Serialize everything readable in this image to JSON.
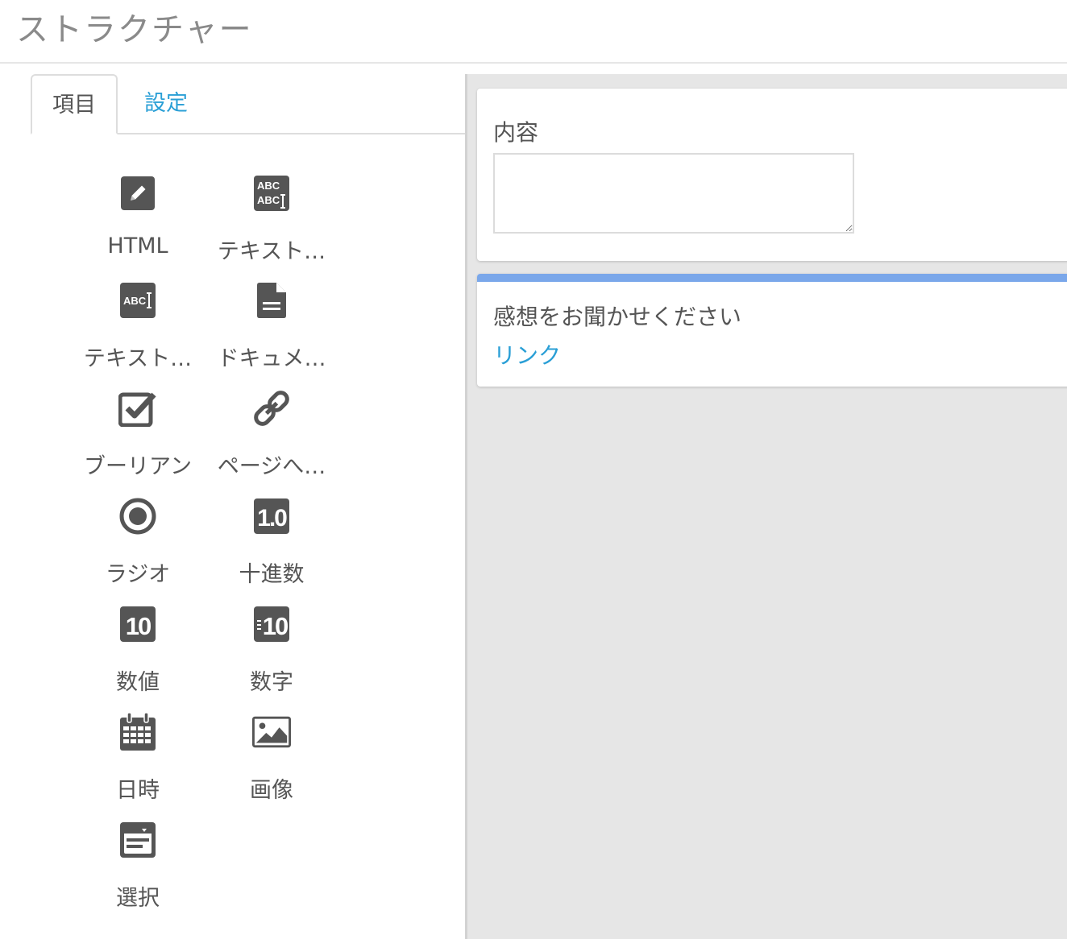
{
  "page": {
    "title": "ストラクチャー"
  },
  "tabs": [
    {
      "label": "項目",
      "active": true
    },
    {
      "label": "設定",
      "active": false
    }
  ],
  "palette": {
    "items": [
      {
        "label": "HTML",
        "icon": "pencil-square-icon"
      },
      {
        "label": "テキスト…",
        "icon": "multiline-text-icon"
      },
      {
        "label": "テキスト…",
        "icon": "text-input-icon"
      },
      {
        "label": "ドキュメ…",
        "icon": "document-icon"
      },
      {
        "label": "ブーリアン",
        "icon": "checkbox-icon"
      },
      {
        "label": "ページへ…",
        "icon": "link-icon"
      },
      {
        "label": "ラジオ",
        "icon": "radio-icon"
      },
      {
        "label": "十進数",
        "icon": "decimal-icon"
      },
      {
        "label": "数値",
        "icon": "number-icon"
      },
      {
        "label": "数字",
        "icon": "numeric-icon"
      },
      {
        "label": "日時",
        "icon": "calendar-icon"
      },
      {
        "label": "画像",
        "icon": "image-icon"
      },
      {
        "label": "選択",
        "icon": "select-icon"
      }
    ],
    "icon_color": "#555555"
  },
  "canvas": {
    "content_card": {
      "label": "内容",
      "value": ""
    },
    "feedback_card": {
      "text": "感想をお聞かせください",
      "link": "リンク",
      "accent_color": "#7aa7ea"
    }
  },
  "colors": {
    "link": "#2a9fd6",
    "canvas_bg": "#e6e6e6"
  }
}
